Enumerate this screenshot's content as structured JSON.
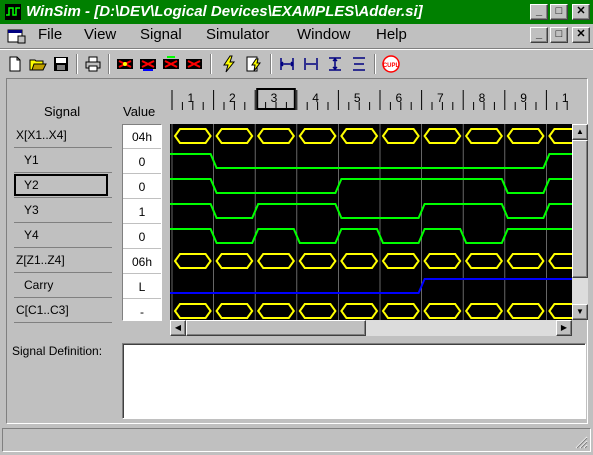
{
  "window": {
    "title": "WinSim - [D:\\DEV\\Logical Devices\\EXAMPLES\\Adder.si]",
    "caption_buttons": [
      "minimize-icon",
      "restore-icon",
      "close-icon"
    ]
  },
  "menu": {
    "items": [
      "File",
      "View",
      "Signal",
      "Simulator",
      "Window",
      "Help"
    ]
  },
  "toolbar": {
    "buttons": [
      "new-file-icon",
      "open-folder-icon",
      "save-icon",
      "print-icon",
      "add-signal-icon",
      "delete-signal-icon",
      "edit-signal-icon",
      "remove-signal-icon",
      "simulate-icon",
      "step-icon",
      "zoom-fit-icon",
      "zoom-in-icon",
      "zoom-out-icon",
      "zoom-reset-icon",
      "cupl-icon"
    ],
    "cupl_label": "CUPL"
  },
  "headers": {
    "signal": "Signal",
    "value": "Value"
  },
  "ruler": {
    "ticks": [
      "1",
      "2",
      "3",
      "4",
      "5",
      "6",
      "7",
      "8",
      "9",
      "1"
    ],
    "selected_tick": "3"
  },
  "signals": [
    {
      "name": "X[X1..X4]",
      "value": "04h",
      "type": "bus",
      "color": "#ffff00"
    },
    {
      "name": "Y1",
      "value": "0",
      "type": "bit",
      "color": "#00ff00",
      "levels": [
        1,
        0,
        0,
        0,
        0,
        0,
        0,
        0,
        0,
        1
      ]
    },
    {
      "name": "Y2",
      "value": "0",
      "type": "bit",
      "color": "#00ff00",
      "levels": [
        1,
        0,
        0,
        0,
        1,
        1,
        1,
        1,
        0,
        1
      ]
    },
    {
      "name": "Y3",
      "value": "1",
      "type": "bit",
      "color": "#00ff00",
      "levels": [
        1,
        0,
        1,
        1,
        0,
        0,
        1,
        1,
        0,
        1
      ]
    },
    {
      "name": "Y4",
      "value": "0",
      "type": "bit",
      "color": "#00ff00",
      "levels": [
        1,
        0,
        1,
        0,
        1,
        0,
        1,
        0,
        1,
        1
      ]
    },
    {
      "name": "Z[Z1..Z4]",
      "value": "06h",
      "type": "bus",
      "color": "#ffff00"
    },
    {
      "name": "Carry",
      "value": "L",
      "type": "bit",
      "color": "#0000ff",
      "levels": [
        0,
        0,
        0,
        0,
        0,
        0,
        1,
        1,
        1,
        1
      ]
    },
    {
      "name": "C[C1..C3]",
      "value": "-",
      "type": "bus",
      "color": "#ffff00"
    }
  ],
  "selected_signal": "Y2",
  "definition": {
    "label": "Signal Definition:",
    "text": ""
  }
}
